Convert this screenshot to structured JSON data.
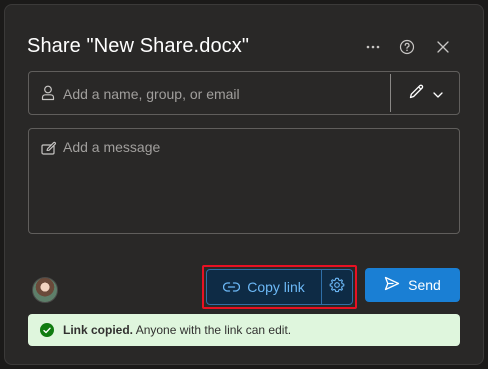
{
  "dialog": {
    "title": "Share \"New Share.docx\"",
    "more_icon": "more-horizontal-icon",
    "help_icon": "help-circle-icon",
    "close_icon": "close-icon"
  },
  "recipient": {
    "placeholder": "Add a name, group, or email",
    "value": "",
    "person_icon": "person-icon",
    "permission_icon": "pencil-icon",
    "dropdown_icon": "chevron-down-icon"
  },
  "message": {
    "placeholder": "Add a message",
    "value": "",
    "icon": "edit-message-icon"
  },
  "actions": {
    "copy_link_label": "Copy link",
    "copy_link_icon": "link-icon",
    "settings_icon": "gear-icon",
    "send_label": "Send",
    "send_icon": "send-icon"
  },
  "status": {
    "bold_text": "Link copied.",
    "text": "Anyone with the link can edit.",
    "icon": "check-circle-icon"
  },
  "colors": {
    "dialog_bg": "#292827",
    "accent": "#1a7fd4",
    "link_text": "#6cb8f6",
    "highlight": "#e81123",
    "success_bg": "#dff6dd",
    "success_icon": "#107c10"
  }
}
